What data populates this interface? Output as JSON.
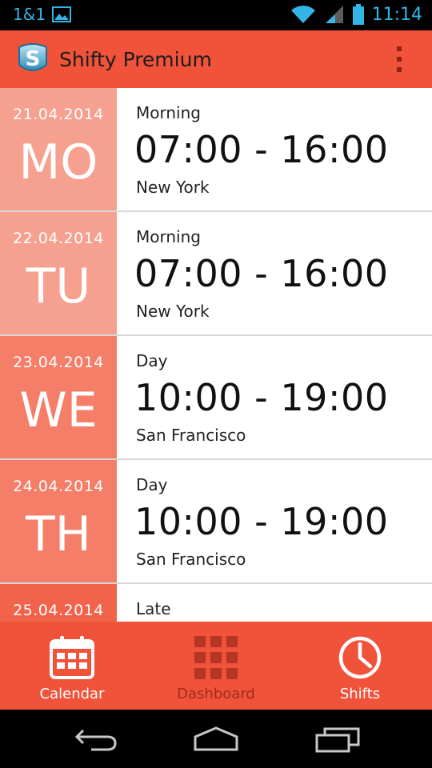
{
  "status_bar": {
    "carrier": "1&1",
    "time": "11:14",
    "icons": [
      "image-icon",
      "wifi-icon",
      "signal-icon",
      "battery-icon"
    ]
  },
  "app": {
    "title": "Shifty Premium",
    "accent": "#f0523a"
  },
  "shifts": [
    {
      "date": "21.04.2014",
      "day": "MO",
      "name": "Morning",
      "time": "07:00 - 16:00",
      "location": "New York",
      "color": "#f6a090"
    },
    {
      "date": "22.04.2014",
      "day": "TU",
      "name": "Morning",
      "time": "07:00 - 16:00",
      "location": "New York",
      "color": "#f6a090"
    },
    {
      "date": "23.04.2014",
      "day": "WE",
      "name": "Day",
      "time": "10:00 - 19:00",
      "location": "San Francisco",
      "color": "#f47e68"
    },
    {
      "date": "24.04.2014",
      "day": "TH",
      "name": "Day",
      "time": "10:00 - 19:00",
      "location": "San Francisco",
      "color": "#f47e68"
    },
    {
      "date": "25.04.2014",
      "day": "",
      "name": "Late",
      "time": "",
      "location": "",
      "color": "#f1634b"
    }
  ],
  "tabs": [
    {
      "label": "Calendar",
      "icon": "calendar-icon",
      "active": true
    },
    {
      "label": "Dashboard",
      "icon": "dashboard-icon",
      "active": false
    },
    {
      "label": "Shifts",
      "icon": "clock-icon",
      "active": true
    }
  ],
  "nav_bar": {
    "icons": [
      "back-icon",
      "home-icon",
      "recents-icon"
    ]
  }
}
